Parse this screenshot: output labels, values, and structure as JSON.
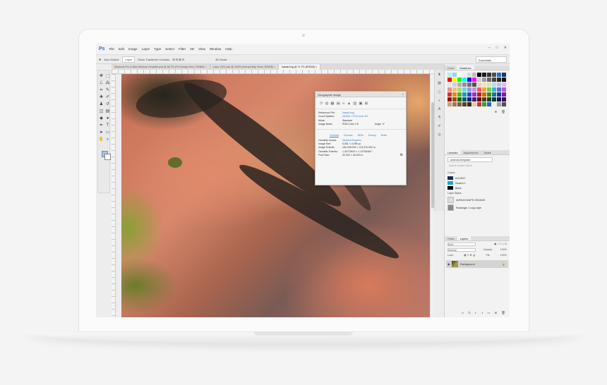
{
  "app": {
    "logo": "Ps",
    "menu": [
      "File",
      "Edit",
      "Image",
      "Layer",
      "Type",
      "Select",
      "Filter",
      "3D",
      "View",
      "Window",
      "Help"
    ],
    "window_controls": [
      "–",
      "□",
      "✕"
    ]
  },
  "options_bar": {
    "auto_select_label": "Auto-Select:",
    "layer_dropdown": "Layer",
    "transform_label": "Show Transform Controls",
    "mode_3d": "3D Mode:",
    "workspace": "Essentials"
  },
  "tabs": [
    {
      "label": "Macbook Pro & iMac Mockup Template.psd @ 66.7% (Put Design Here, RGB/8) ×"
    },
    {
      "label": "Layer 1521.psb @ 100% (Avenza Map Store, RGB/8) ×"
    },
    {
      "label": "hawaii.img @ 71.7% (RGB/8) ×"
    }
  ],
  "tools": [
    {
      "icon": "move-icon",
      "glyph": "✥"
    },
    {
      "icon": "marquee-icon",
      "glyph": "⬚"
    },
    {
      "icon": "lasso-icon",
      "glyph": "ℒ"
    },
    {
      "icon": "magic-wand-icon",
      "glyph": "⁂"
    },
    {
      "icon": "crop-icon",
      "glyph": "⌗"
    },
    {
      "icon": "eyedropper-icon",
      "glyph": "✎"
    },
    {
      "icon": "healing-icon",
      "glyph": "✚"
    },
    {
      "icon": "brush-icon",
      "glyph": "✐"
    },
    {
      "icon": "stamp-icon",
      "glyph": "♟"
    },
    {
      "icon": "history-brush-icon",
      "glyph": "↺"
    },
    {
      "icon": "eraser-icon",
      "glyph": "◫"
    },
    {
      "icon": "gradient-icon",
      "glyph": "▤"
    },
    {
      "icon": "blur-icon",
      "glyph": "◆"
    },
    {
      "icon": "dodge-icon",
      "glyph": "●"
    },
    {
      "icon": "pen-icon",
      "glyph": "✒"
    },
    {
      "icon": "type-icon",
      "glyph": "T"
    },
    {
      "icon": "path-select-icon",
      "glyph": "➤"
    },
    {
      "icon": "shape-icon",
      "glyph": "▭"
    },
    {
      "icon": "hand-icon",
      "glyph": "✋"
    },
    {
      "icon": "zoom-icon",
      "glyph": "⌕"
    }
  ],
  "geo_panel": {
    "title": "Geographic Image",
    "close": "×",
    "rows1": [
      {
        "key": "Reference File:",
        "val": "hawaii.img",
        "link": true
      },
      {
        "key": "Coord System:",
        "val": "NAD83 / UTM zone 4N",
        "link": true
      },
      {
        "key": "Mode:",
        "val": "Standard",
        "link": false
      },
      {
        "key": "Image Mode:",
        "val": "RGB Color 1:8",
        "link": false
      }
    ],
    "angle": "Angle: 0°",
    "tabs": [
      "General",
      "Corners",
      "DEM",
      "Survey",
      "Ruler"
    ],
    "rows2": [
      {
        "key": "Geodetic format:",
        "val": "Decimal Degrees",
        "link": true
      },
      {
        "key": "Image Size:",
        "val": "5,081 × 4,099 px",
        "link": false
      },
      {
        "key": "Image Extents:",
        "val": "152,435.000 × 122,970.000 m",
        "link": false
      },
      {
        "key": "Geodetic Extents:",
        "val": "1.40723619 × 1.10753460 °",
        "link": false
      },
      {
        "key": "Pixel Size:",
        "val": "30.000 × 30.000 m",
        "link": false
      }
    ]
  },
  "swatches_panel": {
    "tabs": [
      "Color",
      "Swatches"
    ],
    "colors": [
      "#bfe8f4",
      "#8fd7ef",
      "#ffffff",
      "#f2f2f2",
      "#d9d9d9",
      "#bfbfbf",
      "#000000",
      "#1a1a1a",
      "#333333",
      "#4d4d4d",
      "#2a6fb0",
      "#0d3b66",
      "#ff0000",
      "#ffff00",
      "#00ff00",
      "#00ffff",
      "#0000ff",
      "#ff00ff",
      "#cccccc",
      "#999999",
      "#666666",
      "#444444",
      "#222222",
      "#111111",
      "#e6e6e6",
      "#d0d0d0",
      "#b0b0b0",
      "#909090",
      "#707070",
      "#505050",
      "#f7c9c9",
      "#f5e0b0",
      "#cfe8b5",
      "#b5e0e8",
      "#b7c3ee",
      "#e3b7ee",
      "#f28c8c",
      "#f2c36b",
      "#a7d97a",
      "#7ad0dc",
      "#8b9ae2",
      "#cf8be2",
      "#e85d5d",
      "#eda63b",
      "#7cc84a",
      "#3bb7c8",
      "#5b6fd8",
      "#b55bd8",
      "#d63333",
      "#e88c0a",
      "#4fb51a",
      "#0fa0b5",
      "#2f48cc",
      "#9a2fcc",
      "#b81e1e",
      "#c46f00",
      "#3a8d12",
      "#0a7d8e",
      "#1f33a0",
      "#7a1fa0",
      "#8a1414",
      "#8f5200",
      "#276608",
      "#065b68",
      "#142273",
      "#581473",
      "#5c0d0d",
      "#5e3600",
      "#1a4505",
      "#043c45",
      "#0d164d",
      "#3a0d4d",
      "#c8a080",
      "#a07850",
      "#786040",
      "#584028",
      "#3c2814",
      "#e8c8a8",
      "#d03030",
      "#30a030",
      "#3060d0",
      "#f0f0f0",
      "#a0a0a0",
      "#505050"
    ]
  },
  "libraries_panel": {
    "tabs": [
      "Libraries",
      "Adjustments",
      "Styles"
    ],
    "library": "android-template",
    "search_placeholder": "Search Adobe Stock",
    "colors_label": "Colors",
    "colors": [
      {
        "label": "#112D57",
        "hex": "#112d57"
      },
      {
        "label": "Swatch 1",
        "hex": "#1fa6c2"
      },
      {
        "label": "Black",
        "hex": "#000000"
      }
    ],
    "styles_label": "Layer Styles",
    "styles": [
      "AVENZA MAPS ORANGE",
      "Rectangle 1 copy style"
    ]
  },
  "layers_panel": {
    "tabs": [
      "Paths",
      "Layers"
    ],
    "filter": "Kind",
    "blend": "Normal",
    "opacity_label": "Opacity:",
    "opacity": "100%",
    "lock_label": "Lock:",
    "fill_label": "Fill:",
    "fill": "100%",
    "layer_name": "Background"
  }
}
